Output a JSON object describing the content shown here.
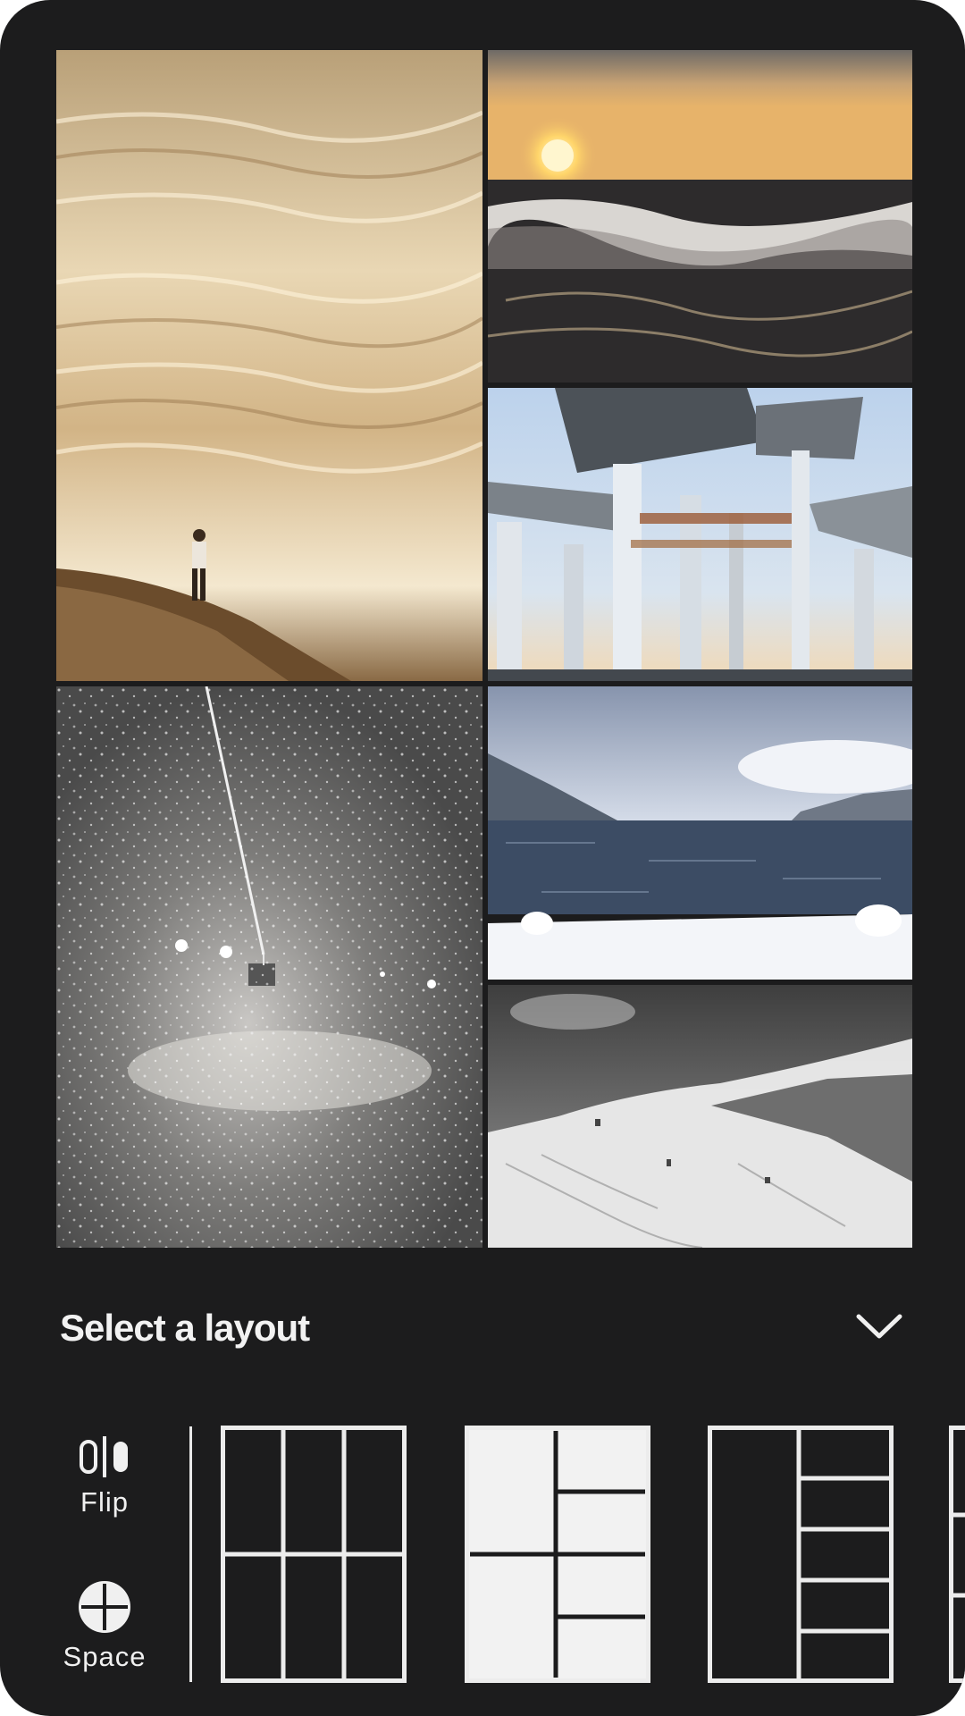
{
  "collage": {
    "photos": [
      {
        "id": "photo-shore-person",
        "icon": "photo"
      },
      {
        "id": "photo-sunset-waves",
        "icon": "photo"
      },
      {
        "id": "photo-concrete-towers",
        "icon": "photo"
      },
      {
        "id": "photo-ski-lift-snow",
        "icon": "photo"
      },
      {
        "id": "photo-winter-lake",
        "icon": "photo"
      },
      {
        "id": "photo-snowy-mountain",
        "icon": "photo"
      }
    ]
  },
  "layout_sheet": {
    "title": "Select a layout",
    "collapse_icon": "chevron-down-icon"
  },
  "tools": {
    "flip": {
      "label": "Flip",
      "icon": "flip-icon"
    },
    "space": {
      "label": "Space",
      "icon": "space-icon"
    }
  },
  "layouts": [
    {
      "name": "grid-3x2"
    },
    {
      "name": "split-left-2-right-4",
      "selected": true
    },
    {
      "name": "big-left-5-stack-right"
    },
    {
      "name": "more-layouts-partial"
    }
  ],
  "colors": {
    "background": "#1c1c1d",
    "text": "#f2f2f2",
    "layout_line": "#ececec",
    "selected_fill": "#f2f2f2"
  }
}
